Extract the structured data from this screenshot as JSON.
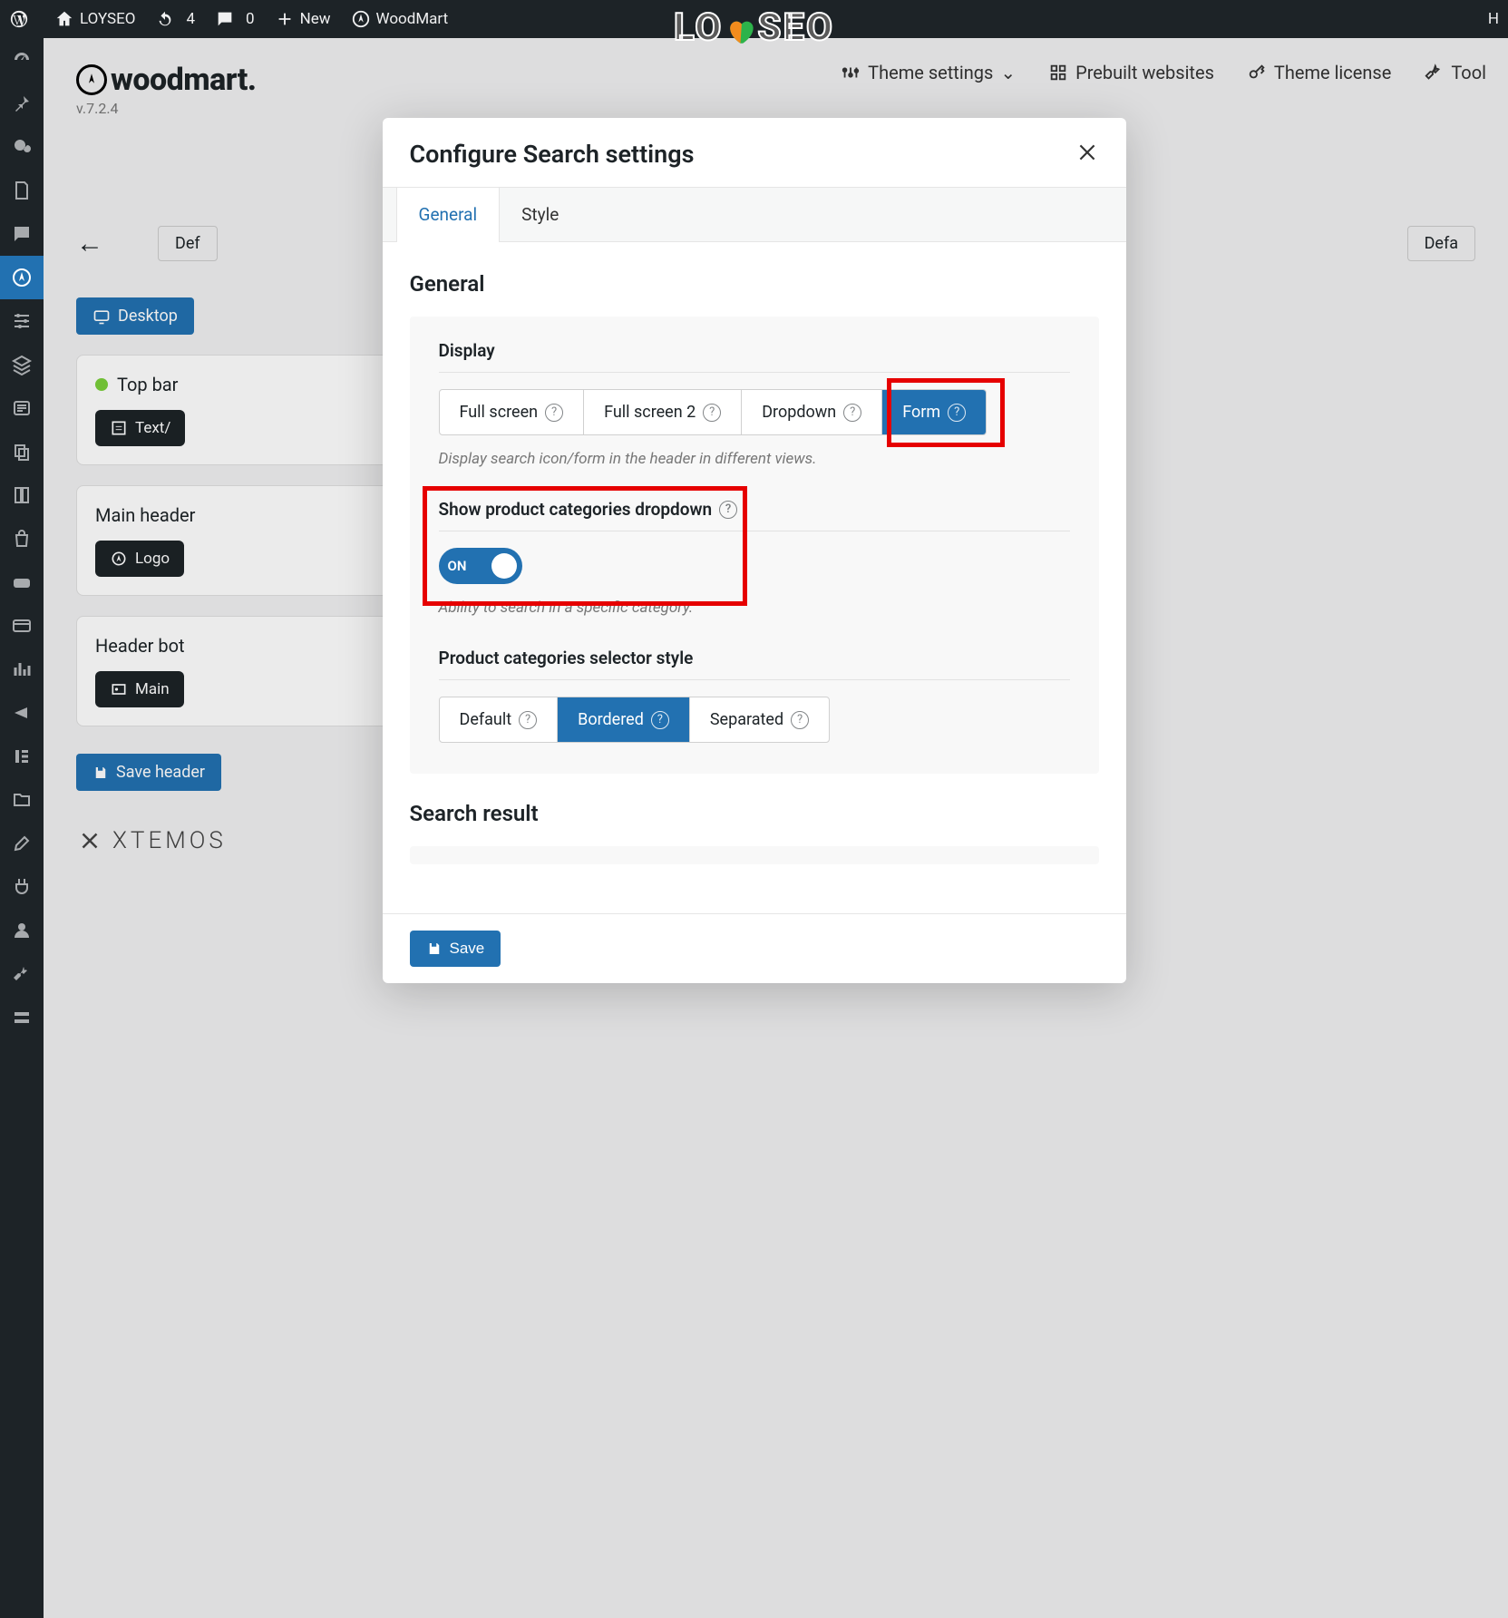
{
  "adminbar": {
    "site_name": "LOYSEO",
    "updates": "4",
    "comments": "0",
    "new": "New",
    "woodmart": "WoodMart",
    "right_cut": "H"
  },
  "brand": {
    "name": "woodmart.",
    "version": "v.7.2.4"
  },
  "top_menu": {
    "theme_settings": "Theme settings",
    "prebuilt": "Prebuilt websites",
    "license": "Theme license",
    "tool": "Tool"
  },
  "back": {
    "def": "Def",
    "defa": "Defa"
  },
  "desktop_btn": "Desktop",
  "panels": {
    "topbar": {
      "title": "Top bar",
      "pill": "Text/"
    },
    "mainheader": {
      "title": "Main header",
      "pill": "Logo"
    },
    "headerbot": {
      "title": "Header bot",
      "pill": "Main"
    }
  },
  "save_header": "Save header",
  "xtemos": "XTEMOS",
  "modal": {
    "title": "Configure Search settings",
    "tabs": {
      "general": "General",
      "style": "Style"
    },
    "section_general": "General",
    "display": {
      "title": "Display",
      "opt_fullscreen": "Full screen",
      "opt_fullscreen2": "Full screen 2",
      "opt_dropdown": "Dropdown",
      "opt_form": "Form",
      "hint": "Display search icon/form in the header in different views."
    },
    "showcat": {
      "title": "Show product categories dropdown",
      "toggle": "ON",
      "hint": "Ability to search in a specific category."
    },
    "selstyle": {
      "title": "Product categories selector style",
      "opt_default": "Default",
      "opt_bordered": "Bordered",
      "opt_separated": "Separated"
    },
    "section_result": "Search result",
    "save": "Save"
  },
  "watermark_a": "LO",
  "watermark_b": "SEO"
}
